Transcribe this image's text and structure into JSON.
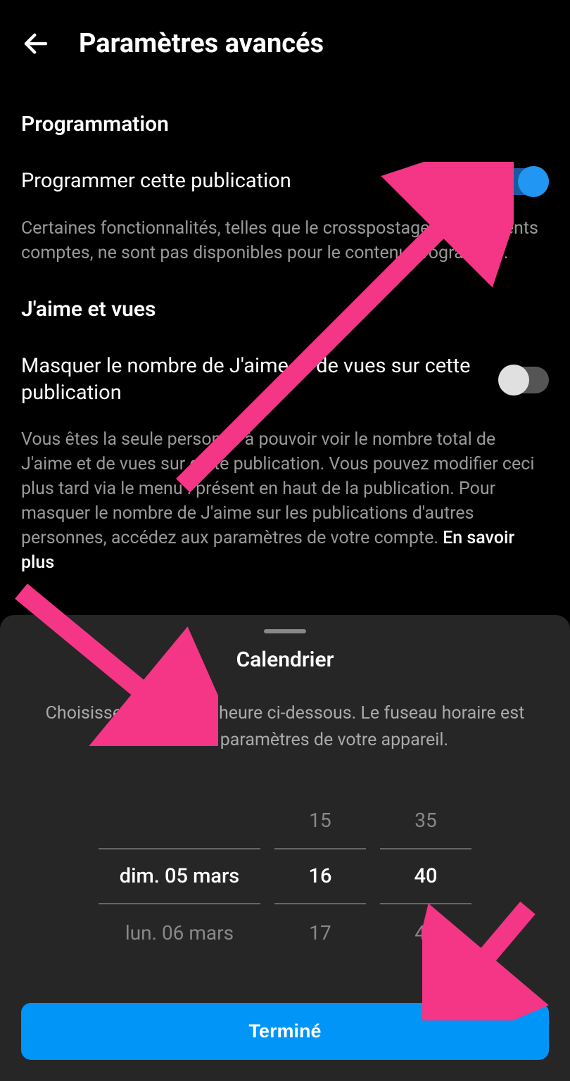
{
  "header": {
    "title": "Paramètres avancés"
  },
  "sections": {
    "scheduling": {
      "title": "Programmation",
      "toggle_label": "Programmer cette publication",
      "toggle_on": true,
      "description": "Certaines fonctionnalités, telles que le crosspostage sur différents comptes, ne sont pas disponibles pour le contenu programmé."
    },
    "likes_views": {
      "title": "J'aime et vues",
      "toggle_label": "Masquer le nombre de J'aime et de vues sur cette publication",
      "toggle_on": false,
      "description": "Vous êtes la seule personne à pouvoir voir le nombre total de J'aime et de vues sur cette publication. Vous pouvez modifier ceci plus tard via le menu : présent en haut de la publication. Pour masquer le nombre de J'aime sur les publications d'autres personnes, accédez aux paramètres de votre compte. ",
      "link_text": "En savoir plus"
    }
  },
  "calendar_sheet": {
    "title": "Calendrier",
    "description": "Choisissez la date et l'heure ci-dessous. Le fuseau horaire est basé sur les paramètres de votre appareil.",
    "picker": {
      "date_prev": "",
      "date_selected": "dim. 05 mars",
      "date_next": "lun. 06 mars",
      "hour_prev": "15",
      "hour_selected": "16",
      "hour_next": "17",
      "minute_prev": "35",
      "minute_selected": "40",
      "minute_next": "45"
    },
    "done_button": "Terminé"
  },
  "colors": {
    "accent": "#0095f6",
    "toggle_on": "#2196f3",
    "annotation": "#f53585"
  }
}
